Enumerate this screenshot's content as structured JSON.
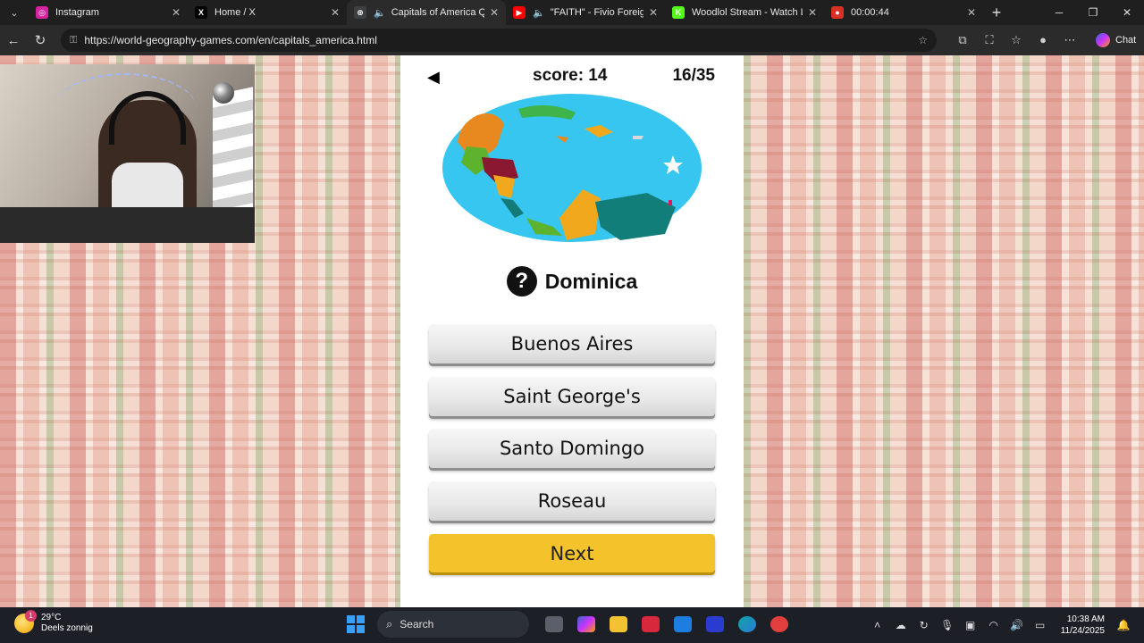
{
  "browser": {
    "tabs": [
      {
        "title": "Instagram",
        "color": "#d6249f",
        "glyph": "◎",
        "audio": false
      },
      {
        "title": "Home / X",
        "color": "#000000",
        "glyph": "X",
        "audio": false
      },
      {
        "title": "Capitals of America Qui",
        "color": "#3c4043",
        "glyph": "⊕",
        "audio": true
      },
      {
        "title": "\"FAITH\" - Fivio Foreign",
        "color": "#ff0000",
        "glyph": "▶",
        "audio": true
      },
      {
        "title": "Woodlol Stream - Watch Liv",
        "color": "#53fc18",
        "glyph": "K",
        "audio": false
      },
      {
        "title": "00:00:44",
        "color": "#d93025",
        "glyph": "●",
        "audio": false
      }
    ],
    "url": "https://world-geography-games.com/en/capitals_america.html",
    "chat_label": "Chat"
  },
  "game": {
    "score_text": "score: 14",
    "progress_text": "16/35",
    "question_icon": "?",
    "question": "Dominica",
    "answers": [
      "Buenos Aires",
      "Saint George's",
      "Santo Domingo",
      "Roseau"
    ],
    "next_label": "Next"
  },
  "taskbar": {
    "weather_temp": "29°C",
    "weather_desc": "Deels zonnig",
    "weather_badge": "1",
    "search_label": "Search",
    "time": "10:38 AM",
    "date": "11/24/2025"
  }
}
